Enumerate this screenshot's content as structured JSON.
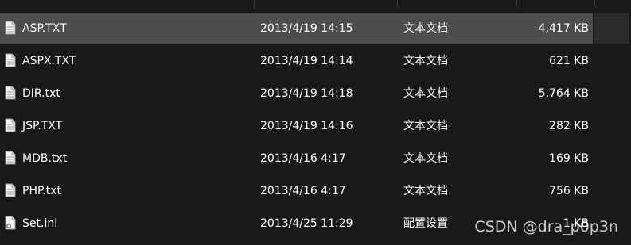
{
  "files": [
    {
      "name": "ASP.TXT",
      "date": "2013/4/19 14:15",
      "type": "文本文档",
      "size": "4,417 KB",
      "icon": "text-file-icon",
      "selected": true
    },
    {
      "name": "ASPX.TXT",
      "date": "2013/4/19 14:14",
      "type": "文本文档",
      "size": "621 KB",
      "icon": "text-file-icon",
      "selected": false
    },
    {
      "name": "DIR.txt",
      "date": "2013/4/19 14:18",
      "type": "文本文档",
      "size": "5,764 KB",
      "icon": "text-file-icon",
      "selected": false
    },
    {
      "name": "JSP.TXT",
      "date": "2013/4/19 14:16",
      "type": "文本文档",
      "size": "282 KB",
      "icon": "text-file-icon",
      "selected": false
    },
    {
      "name": "MDB.txt",
      "date": "2013/4/16 4:17",
      "type": "文本文档",
      "size": "169 KB",
      "icon": "text-file-icon",
      "selected": false
    },
    {
      "name": "PHP.txt",
      "date": "2013/4/16 4:17",
      "type": "文本文档",
      "size": "756 KB",
      "icon": "text-file-icon",
      "selected": false
    },
    {
      "name": "Set.ini",
      "date": "2013/4/25 11:29",
      "type": "配置设置",
      "size": "1 KB",
      "icon": "config-file-icon",
      "selected": false
    }
  ],
  "watermark": "CSDN @dra_p0p3n",
  "colors": {
    "background": "#191919",
    "selected_row": "#4d4d4d",
    "text": "#ffffff"
  }
}
